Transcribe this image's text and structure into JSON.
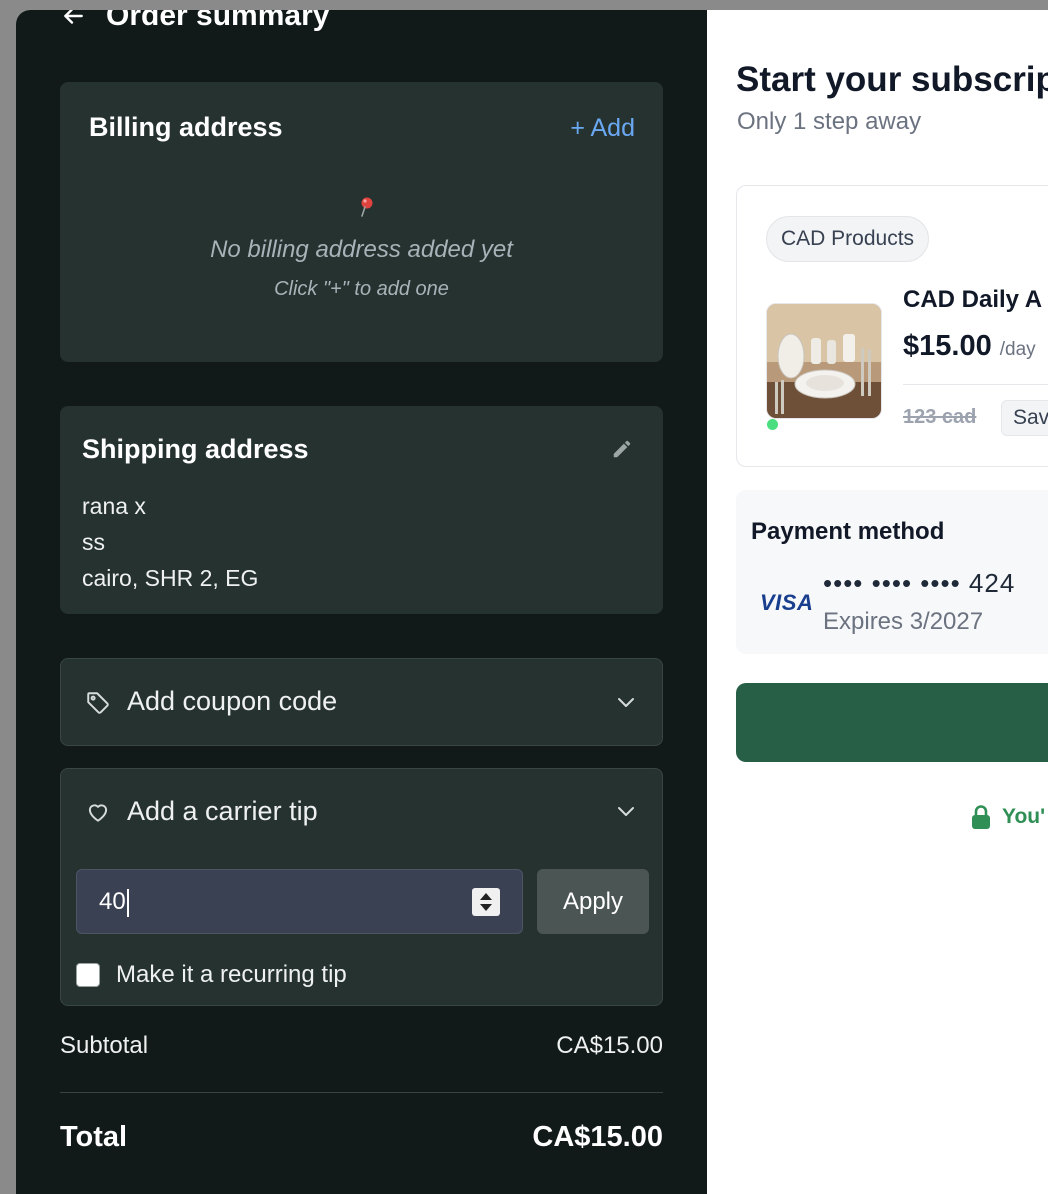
{
  "header": {
    "title": "Order summary"
  },
  "billing": {
    "title": "Billing address",
    "add_label": "+ Add",
    "empty_title": "No billing address added yet",
    "empty_hint": "Click \"+\" to add one"
  },
  "shipping": {
    "title": "Shipping address",
    "lines": [
      "rana x",
      "ss",
      "cairo, SHR 2, EG"
    ]
  },
  "coupon": {
    "label": "Add coupon code"
  },
  "tip": {
    "label": "Add a carrier tip",
    "value": "40",
    "apply_label": "Apply",
    "recurring_label": "Make it a recurring tip",
    "recurring_checked": false
  },
  "totals": {
    "subtotal_label": "Subtotal",
    "subtotal_value": "CA$15.00",
    "total_label": "Total",
    "total_value": "CA$15.00"
  },
  "subscription": {
    "title": "Start your subscrip",
    "subtitle": "Only 1 step away",
    "chip": "CAD Products",
    "product_name": "CAD Daily A",
    "price": "$15.00",
    "period": "/day",
    "old_price": "123 cad",
    "save_badge": "Sav",
    "payment_title": "Payment method",
    "card_brand": "VISA",
    "card_number": "•••• •••• •••• 424",
    "card_expiry": "Expires 3/2027",
    "secure_text": "You'"
  },
  "colors": {
    "panel_bg": "#111a18",
    "card_bg": "#263230",
    "link_blue": "#6aa8f2",
    "cta_green": "#265f45",
    "secure_green": "#2f8f55"
  }
}
